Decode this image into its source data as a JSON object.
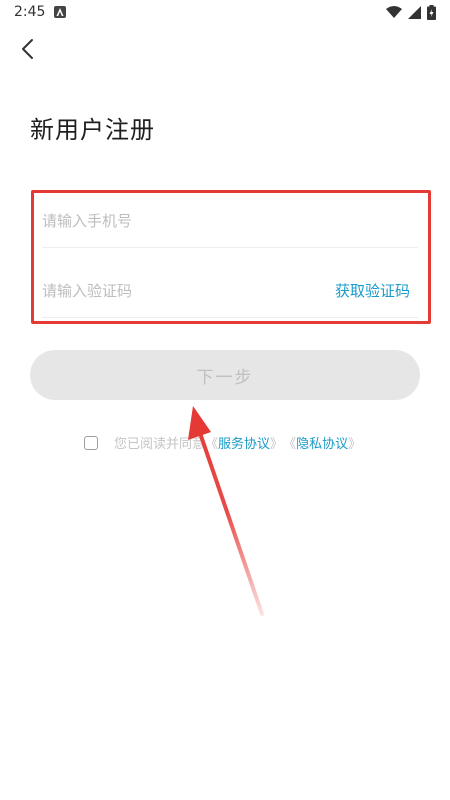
{
  "status_bar": {
    "time": "2:45",
    "icons": [
      "notification-icon",
      "wifi-icon",
      "signal-icon",
      "battery-icon"
    ]
  },
  "nav": {
    "back_icon": "chevron-left-icon"
  },
  "page": {
    "title": "新用户注册"
  },
  "form": {
    "phone_placeholder": "请输入手机号",
    "code_placeholder": "请输入验证码",
    "get_code_label": "获取验证码"
  },
  "next_button": {
    "label": "下一步"
  },
  "agreement": {
    "prefix": "您已阅读并同意",
    "service_link": "服务协议",
    "privacy_link": "隐私协议",
    "open_bracket": "《",
    "close_bracket": "》"
  },
  "colors": {
    "accent": "#1a9bc9",
    "highlight_border": "#e53935",
    "disabled_button_bg": "#e6e6e6"
  }
}
